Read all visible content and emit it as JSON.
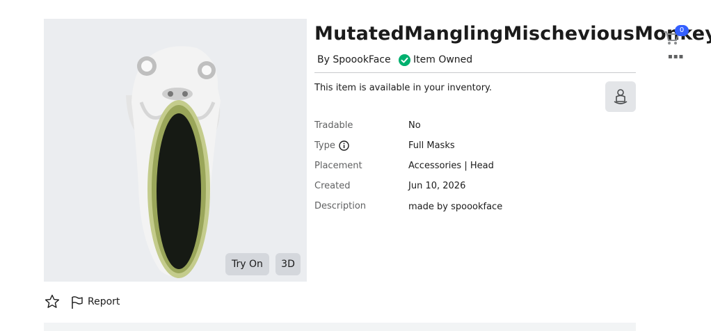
{
  "item": {
    "name": "MutatedManglingMischeviousMonkey",
    "by_prefix": "By",
    "creator": "SpoookFace",
    "owned_label": "Item Owned",
    "availability_text": "This item is available in your inventory."
  },
  "thumbnail": {
    "try_on_label": "Try On",
    "view_3d_label": "3D"
  },
  "cart": {
    "count": "0"
  },
  "details": {
    "tradable_label": "Tradable",
    "tradable_value": "No",
    "type_label": "Type",
    "type_value": "Full Masks",
    "placement_label": "Placement",
    "placement_value": "Accessories | Head",
    "created_label": "Created",
    "created_value": "Jun 10, 2026",
    "description_label": "Description",
    "description_value": "made by spoookface"
  },
  "actions": {
    "report_label": "Report"
  },
  "colors": {
    "owned_green": "#00b06f",
    "cart_badge_blue": "#335fff",
    "thumbnail_bg": "#ebedf0"
  },
  "icons": [
    "cart-icon",
    "more-icon",
    "check-circle-icon",
    "inventory-icon",
    "info-icon",
    "star-icon",
    "flag-icon"
  ]
}
